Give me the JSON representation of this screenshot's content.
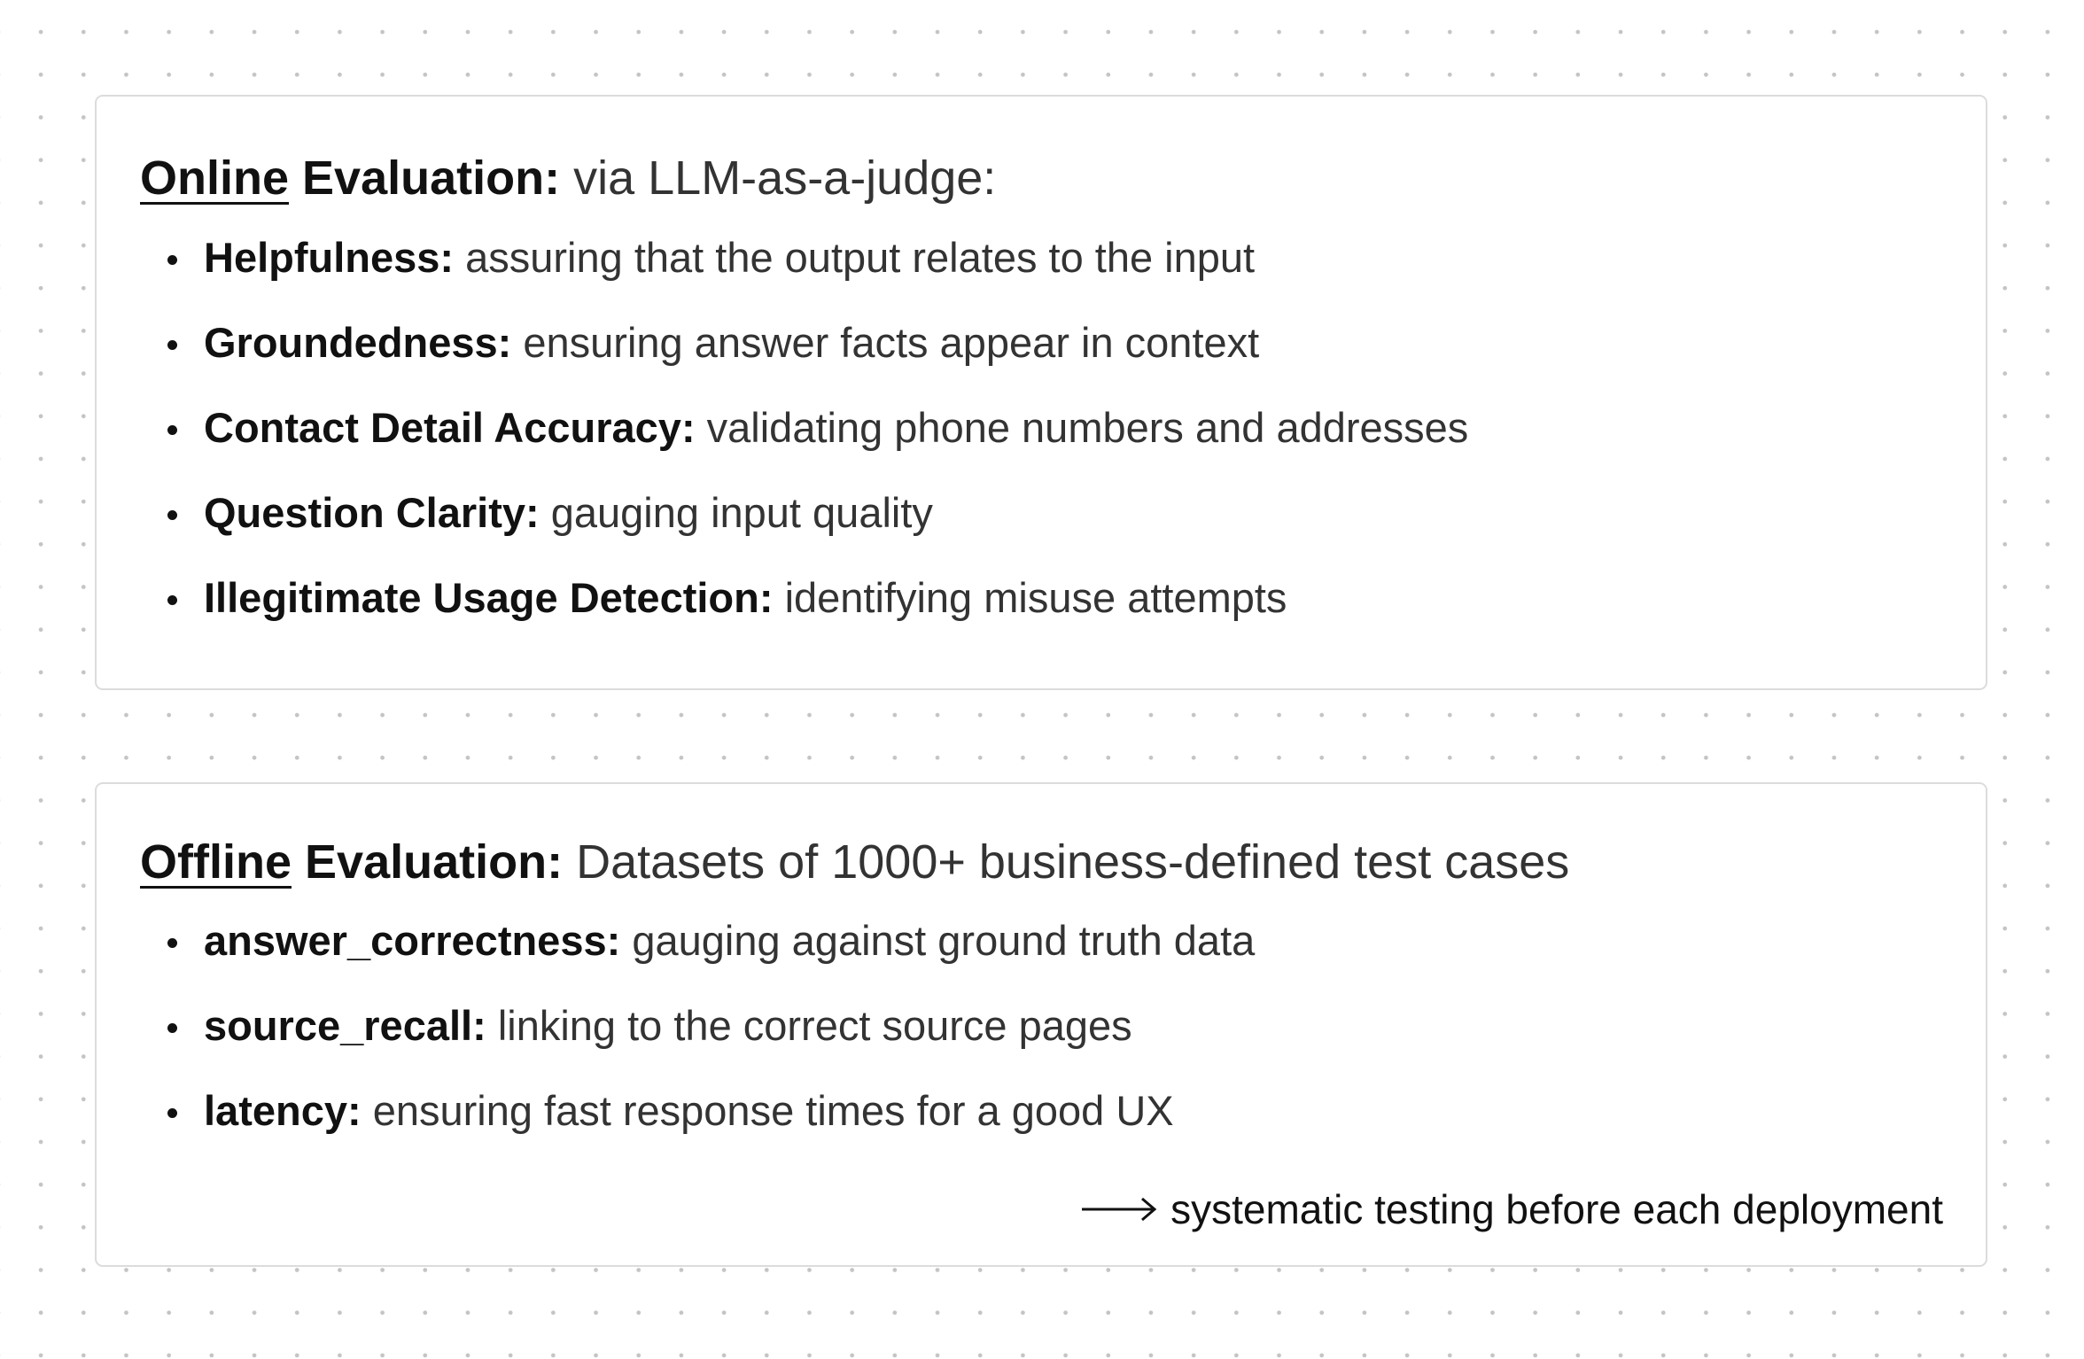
{
  "online": {
    "heading_emph": "Online",
    "heading_strong": "Evaluation:",
    "heading_rest": "via LLM-as-a-judge:",
    "items": [
      {
        "term": "Helpfulness:",
        "desc": "assuring that the output relates to the input"
      },
      {
        "term": "Groundedness:",
        "desc": "ensuring answer facts appear in context"
      },
      {
        "term": "Contact Detail Accuracy:",
        "desc": "validating phone numbers and addresses"
      },
      {
        "term": "Question Clarity:",
        "desc": "gauging input quality"
      },
      {
        "term": "Illegitimate Usage Detection:",
        "desc": "identifying misuse attempts"
      }
    ]
  },
  "offline": {
    "heading_emph": "Offline",
    "heading_strong": "Evaluation:",
    "heading_rest": "Datasets of 1000+ business-defined test cases",
    "items": [
      {
        "term": "answer_correctness:",
        "desc": "gauging against ground truth data"
      },
      {
        "term": "source_recall:",
        "desc": "linking to the correct source pages"
      },
      {
        "term": "latency:",
        "desc": "ensuring fast response times for a good UX"
      }
    ],
    "footnote": {
      "icon": "arrow-right-icon",
      "text": "systematic testing before each deployment"
    }
  },
  "colors": {
    "background": "#ffffff",
    "dot_grid": "#c4c4c4",
    "card_border": "#dcdcdc",
    "text_strong": "#111111",
    "text_body": "#333333"
  }
}
